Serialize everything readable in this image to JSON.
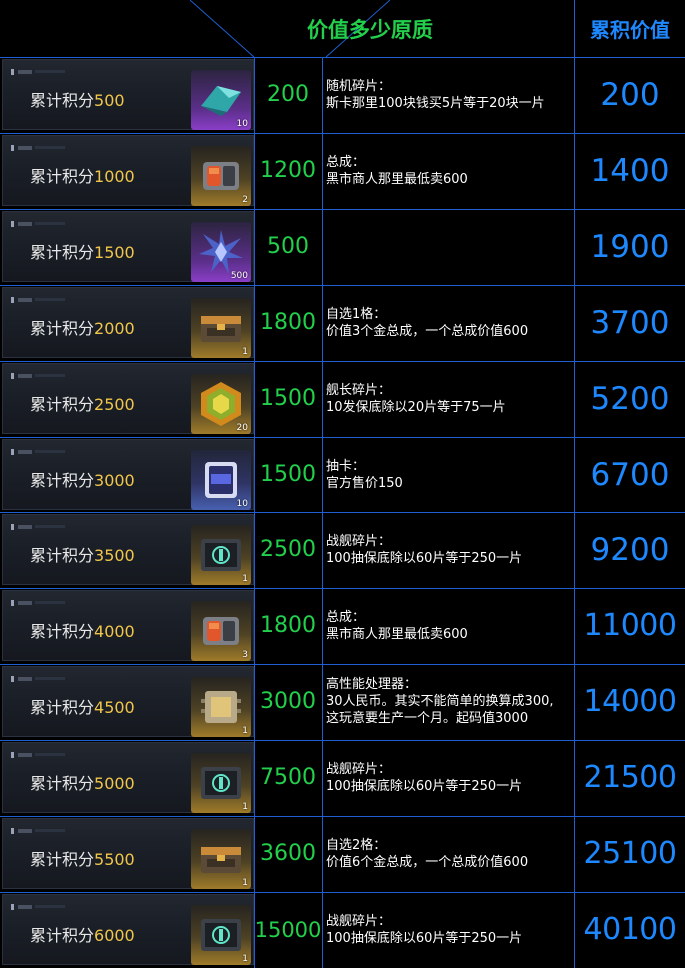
{
  "header": {
    "value_title": "价值多少原质",
    "cumulative_title": "累积价值"
  },
  "colors": {
    "value_green": "#22d04b",
    "cumulative_blue": "#1e88ff",
    "points_gold": "#f1c64a",
    "grid_blue": "#1f5fd1"
  },
  "rows": [
    {
      "label": "累计积分",
      "points": "500",
      "item_count": "10",
      "item_icon": "shard-icon",
      "value": "200",
      "note_title": "随机碎片：",
      "note_body": [
        "斯卡那里100块钱买5片等于20块一片"
      ],
      "cumulative": "200"
    },
    {
      "label": "累计积分",
      "points": "1000",
      "item_count": "2",
      "item_icon": "assembly-icon",
      "value": "1200",
      "note_title": "总成：",
      "note_body": [
        "黑市商人那里最低卖600"
      ],
      "cumulative": "1400"
    },
    {
      "label": "累计积分",
      "points": "1500",
      "item_count": "500",
      "item_icon": "crystal-icon",
      "value": "500",
      "note_title": "",
      "note_body": [],
      "cumulative": "1900"
    },
    {
      "label": "累计积分",
      "points": "2000",
      "item_count": "1",
      "item_icon": "chest-icon",
      "value": "1800",
      "note_title": "自选1格：",
      "note_body": [
        "价值3个金总成，一个总成价值600"
      ],
      "cumulative": "3700"
    },
    {
      "label": "累计积分",
      "points": "2500",
      "item_count": "20",
      "item_icon": "hexagon-icon",
      "value": "1500",
      "note_title": "舰长碎片：",
      "note_body": [
        "10发保底除以20片等于75一片"
      ],
      "cumulative": "5200"
    },
    {
      "label": "累计积分",
      "points": "3000",
      "item_count": "10",
      "item_icon": "card-icon",
      "value": "1500",
      "note_title": "抽卡：",
      "note_body": [
        "官方售价150"
      ],
      "cumulative": "6700"
    },
    {
      "label": "累计积分",
      "points": "3500",
      "item_count": "1",
      "item_icon": "warship-box-icon",
      "value": "2500",
      "note_title": "战舰碎片：",
      "note_body": [
        "100抽保底除以60片等于250一片"
      ],
      "cumulative": "9200"
    },
    {
      "label": "累计积分",
      "points": "4000",
      "item_count": "3",
      "item_icon": "assembly-icon",
      "value": "1800",
      "note_title": "总成：",
      "note_body": [
        "黑市商人那里最低卖600"
      ],
      "cumulative": "11000"
    },
    {
      "label": "累计积分",
      "points": "4500",
      "item_count": "1",
      "item_icon": "processor-icon",
      "value": "3000",
      "note_title": "高性能处理器：",
      "note_body": [
        "30人民币。其实不能简单的换算成300,",
        "这玩意要生产一个月。起码值3000"
      ],
      "cumulative": "14000"
    },
    {
      "label": "累计积分",
      "points": "5000",
      "item_count": "1",
      "item_icon": "warship-box-icon",
      "value": "7500",
      "note_title": "战舰碎片：",
      "note_body": [
        "100抽保底除以60片等于250一片"
      ],
      "cumulative": "21500"
    },
    {
      "label": "累计积分",
      "points": "5500",
      "item_count": "1",
      "item_icon": "chest-icon",
      "value": "3600",
      "note_title": "自选2格：",
      "note_body": [
        "价值6个金总成，一个总成价值600"
      ],
      "cumulative": "25100"
    },
    {
      "label": "累计积分",
      "points": "6000",
      "item_count": "1",
      "item_icon": "warship-box-icon",
      "value": "15000",
      "note_title": "战舰碎片：",
      "note_body": [
        "100抽保底除以60片等于250一片"
      ],
      "cumulative": "40100"
    }
  ]
}
